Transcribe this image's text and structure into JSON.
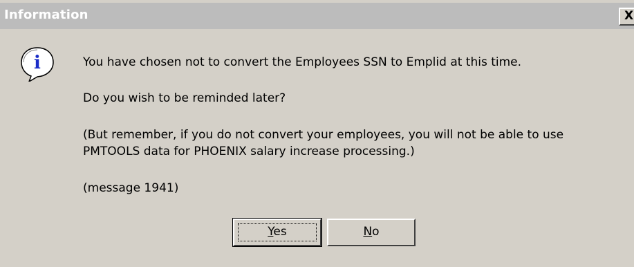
{
  "window": {
    "title": "Information",
    "close_glyph": "X"
  },
  "icon": {
    "name": "information-icon",
    "glyph": "i"
  },
  "message": {
    "line1": "You have chosen not to convert the Employees SSN to Emplid at this time.",
    "line2": "Do you wish to be reminded later?",
    "line3a": "(But remember, if you do not convert your employees, you will not be able to use",
    "line3b": "PMTOOLS data for PHOENIX salary increase processing.)",
    "line4": "(message 1941)"
  },
  "buttons": {
    "yes_mnemonic": "Y",
    "yes_rest": "es",
    "no_mnemonic": "N",
    "no_rest": "o"
  },
  "colors": {
    "dialog_bg": "#d4d0c8",
    "titlebar_bg": "#bcbcbc",
    "icon_blue": "#1a2cc8"
  }
}
